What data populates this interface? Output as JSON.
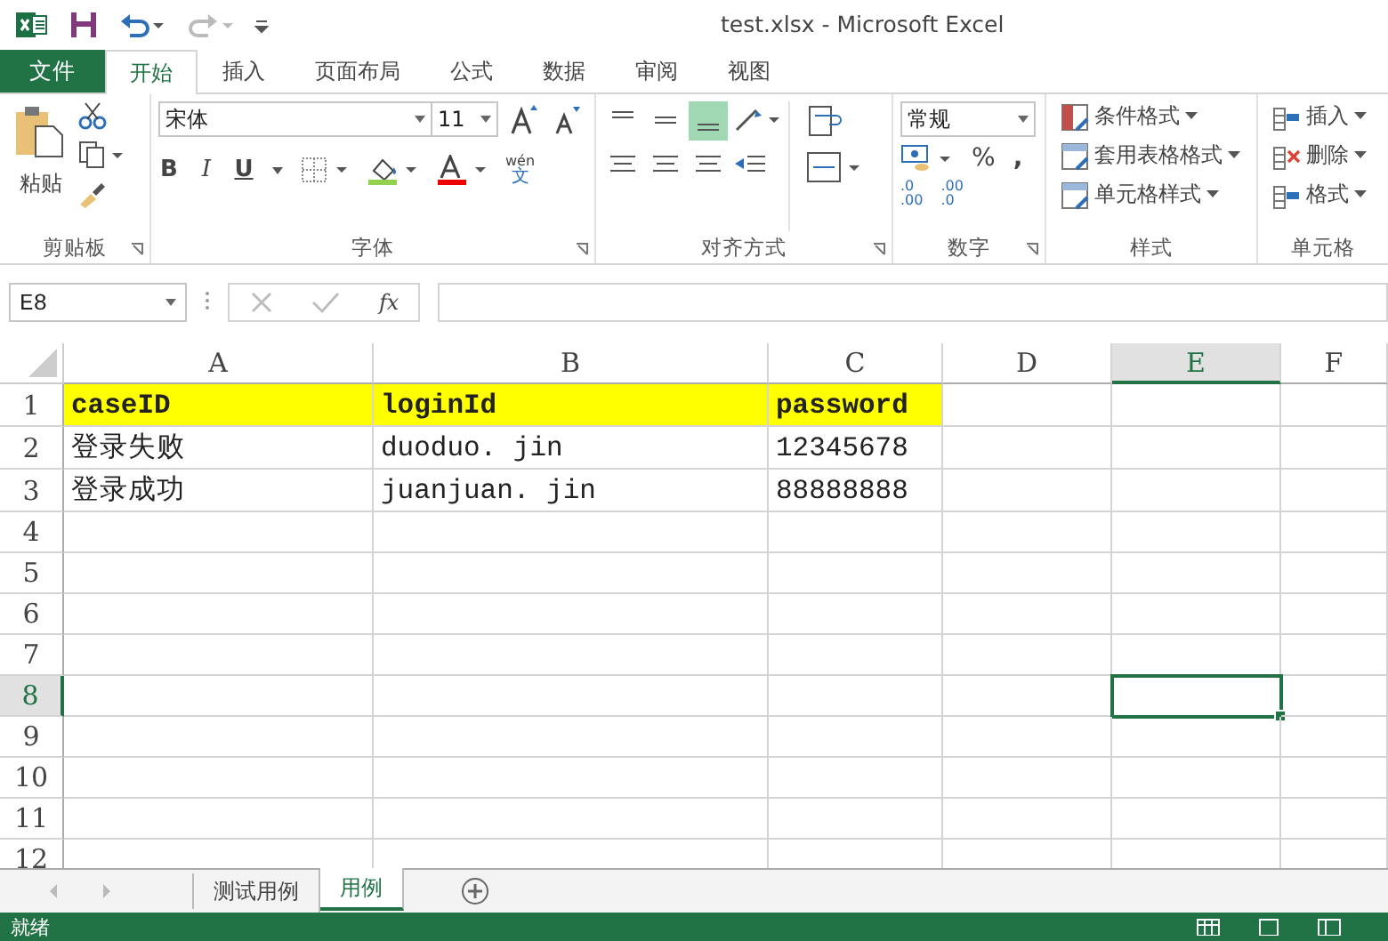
{
  "window": {
    "title": "test.xlsx - Microsoft Excel"
  },
  "ribbon_tabs": [
    {
      "label": "文件",
      "kind": "file",
      "selected": false
    },
    {
      "label": "开始",
      "kind": "tab",
      "selected": true
    },
    {
      "label": "插入",
      "kind": "tab",
      "selected": false
    },
    {
      "label": "页面布局",
      "kind": "tab",
      "selected": false
    },
    {
      "label": "公式",
      "kind": "tab",
      "selected": false
    },
    {
      "label": "数据",
      "kind": "tab",
      "selected": false
    },
    {
      "label": "审阅",
      "kind": "tab",
      "selected": false
    },
    {
      "label": "视图",
      "kind": "tab",
      "selected": false
    }
  ],
  "clipboard": {
    "label": "剪贴板",
    "paste": "粘贴"
  },
  "font": {
    "label": "字体",
    "font_name": "宋体",
    "font_size": "11",
    "bold": "B",
    "italic": "I",
    "underline": "U",
    "phonetic_top": "wén",
    "phonetic_bottom": "文"
  },
  "alignment": {
    "label": "对齐方式"
  },
  "number": {
    "label": "数字",
    "format": "常规",
    "percent": "%",
    "comma": ",",
    "decimal_up": [
      ".0",
      ".00"
    ],
    "decimal_down": [
      ".00",
      ".0"
    ]
  },
  "styles": {
    "label": "样式",
    "buttons": [
      "条件格式",
      "套用表格格式",
      "单元格样式"
    ]
  },
  "cells_group": {
    "label": "单元格",
    "buttons": [
      "插入",
      "删除",
      "格式"
    ]
  },
  "formula_bar": {
    "name_box": "E8",
    "function_label": "fx"
  },
  "columns": [
    {
      "label": "A",
      "selected": false
    },
    {
      "label": "B",
      "selected": false
    },
    {
      "label": "C",
      "selected": false
    },
    {
      "label": "D",
      "selected": false
    },
    {
      "label": "E",
      "selected": true
    },
    {
      "label": "F",
      "selected": false
    }
  ],
  "rows": [
    {
      "label": "1",
      "selected": false,
      "highlight": true,
      "cells": [
        "caseID",
        "loginId",
        "password"
      ]
    },
    {
      "label": "2",
      "selected": false,
      "highlight": false,
      "cells": [
        "登录失败",
        "duoduo. jin",
        "12345678"
      ]
    },
    {
      "label": "3",
      "selected": false,
      "highlight": false,
      "cells": [
        "登录成功",
        "juanjuan. jin",
        "88888888"
      ]
    },
    {
      "label": "4",
      "selected": false,
      "highlight": false,
      "cells": []
    },
    {
      "label": "5",
      "selected": false,
      "highlight": false,
      "cells": []
    },
    {
      "label": "6",
      "selected": false,
      "highlight": false,
      "cells": []
    },
    {
      "label": "7",
      "selected": false,
      "highlight": false,
      "cells": []
    },
    {
      "label": "8",
      "selected": true,
      "highlight": false,
      "cells": []
    },
    {
      "label": "9",
      "selected": false,
      "highlight": false,
      "cells": []
    },
    {
      "label": "10",
      "selected": false,
      "highlight": false,
      "cells": []
    },
    {
      "label": "11",
      "selected": false,
      "highlight": false,
      "cells": []
    },
    {
      "label": "12",
      "selected": false,
      "highlight": false,
      "cells": []
    }
  ],
  "sheet_tabs": [
    {
      "label": "测试用例",
      "selected": false
    },
    {
      "label": "用例",
      "selected": true
    }
  ],
  "status_bar": {
    "text": "就绪"
  }
}
